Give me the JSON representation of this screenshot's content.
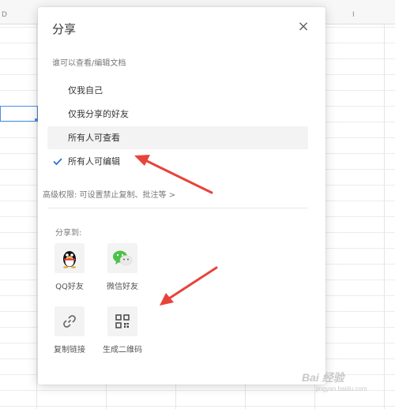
{
  "sheet": {
    "column_marker": "D",
    "column_marker_right": "I"
  },
  "dialog": {
    "title": "分享",
    "close_symbol": "×",
    "permission_heading": "谁可以查看/编辑文档",
    "permissions": [
      {
        "label": "仅我自己",
        "selected": false
      },
      {
        "label": "仅我分享的好友",
        "selected": false
      },
      {
        "label": "所有人可查看",
        "selected": false
      },
      {
        "label": "所有人可编辑",
        "selected": true
      }
    ],
    "advanced_link": "高级权限: 可设置禁止复制、批注等 >",
    "share_heading": "分享到:",
    "share_options": [
      {
        "label": "QQ好友",
        "icon": "qq-penguin-icon"
      },
      {
        "label": "微信好友",
        "icon": "wechat-icon"
      },
      {
        "label": "复制链接",
        "icon": "link-icon"
      },
      {
        "label": "生成二维码",
        "icon": "qr-code-icon"
      }
    ]
  },
  "annotations": {
    "arrow_color": "#e8433a"
  },
  "watermark": {
    "text": "Bai 经验",
    "sub": "jingyan.baidu.com"
  },
  "colors": {
    "check": "#2f6fd8",
    "wechat": "#4cc247",
    "hover_row": "#f3f3f3"
  }
}
